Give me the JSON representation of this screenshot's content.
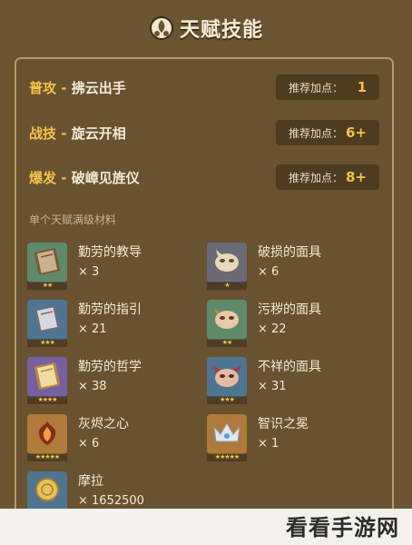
{
  "header": {
    "title": "天赋技能",
    "icon": "talent-emblem-icon"
  },
  "skills": [
    {
      "type": "普攻",
      "dash": " - ",
      "name": "拂云出手",
      "rec_label": "推荐加点：",
      "rec_value": "1"
    },
    {
      "type": "战技",
      "dash": " - ",
      "name": "旋云开相",
      "rec_label": "推荐加点：",
      "rec_value": "6+"
    },
    {
      "type": "爆发",
      "dash": " - ",
      "name": "破嶂见旌仪",
      "rec_label": "推荐加点：",
      "rec_value": "8+"
    }
  ],
  "materials_label": "单个天赋满级材料",
  "materials": [
    {
      "name": "勤劳的教导",
      "count": "× 3",
      "stars": "★★",
      "rarity_color": "#5e8a6a",
      "icon": "book-icon"
    },
    {
      "name": "破损的面具",
      "count": "× 6",
      "stars": "★",
      "rarity_color": "#6a6b74",
      "icon": "mask-icon"
    },
    {
      "name": "勤劳的指引",
      "count": "× 21",
      "stars": "★★★",
      "rarity_color": "#4e7592",
      "icon": "book-icon"
    },
    {
      "name": "污秽的面具",
      "count": "× 22",
      "stars": "★★",
      "rarity_color": "#5e8a6a",
      "icon": "mask-icon"
    },
    {
      "name": "勤劳的哲学",
      "count": "× 38",
      "stars": "★★★★",
      "rarity_color": "#7660a1",
      "icon": "book-icon"
    },
    {
      "name": "不祥的面具",
      "count": "× 31",
      "stars": "★★★",
      "rarity_color": "#4e7592",
      "icon": "mask-icon"
    },
    {
      "name": "灰烬之心",
      "count": "× 6",
      "stars": "★★★★★",
      "rarity_color": "#b07a3a",
      "icon": "ember-heart-icon"
    },
    {
      "name": "智识之冕",
      "count": "× 1",
      "stars": "★★★★★",
      "rarity_color": "#b07a3a",
      "icon": "crown-icon"
    },
    {
      "name": "摩拉",
      "count": "× 1652500",
      "stars": "★★★",
      "rarity_color": "#4e7592",
      "icon": "mora-coin-icon"
    }
  ],
  "watermark": "看看手游网"
}
